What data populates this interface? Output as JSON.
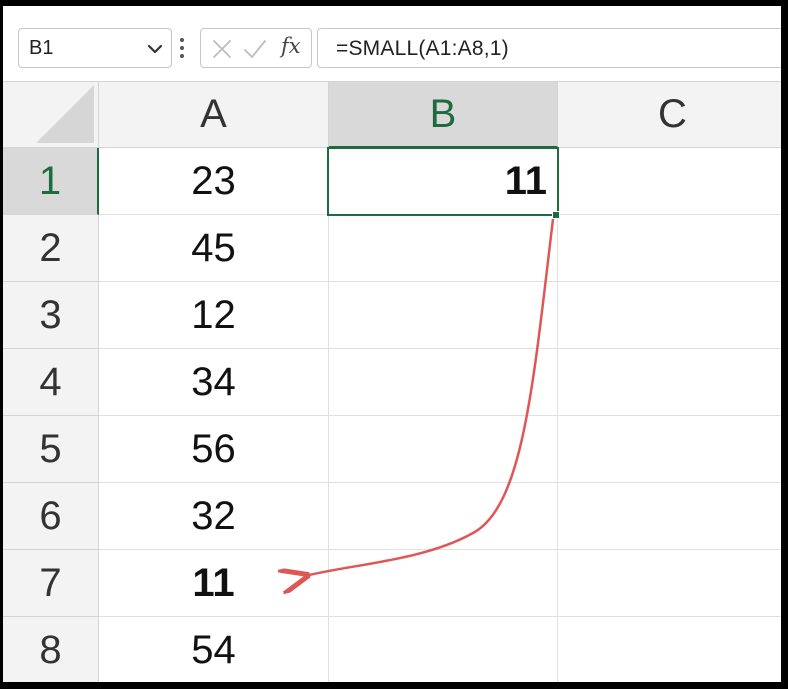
{
  "formula_bar": {
    "name_box": "B1",
    "formula": "=SMALL(A1:A8,1)",
    "fx_label": "fx"
  },
  "columns": [
    "A",
    "B",
    "C"
  ],
  "rows": [
    "1",
    "2",
    "3",
    "4",
    "5",
    "6",
    "7",
    "8"
  ],
  "cells": {
    "A1": "23",
    "A2": "45",
    "A3": "12",
    "A4": "34",
    "A5": "56",
    "A6": "32",
    "A7": "11",
    "A8": "54",
    "B1": "11"
  },
  "selection": {
    "active_cell": "B1",
    "active_column": "B",
    "active_row": "1"
  },
  "colors": {
    "accent": "#1e6b3f",
    "arrow": "#e05555",
    "header_bg": "#f3f3f3",
    "grid": "#e0e0e0"
  },
  "icons": [
    "chevron-down-icon",
    "more-vert-icon",
    "cancel-x-icon",
    "confirm-check-icon",
    "function-fx-icon",
    "select-all-triangle-icon"
  ]
}
